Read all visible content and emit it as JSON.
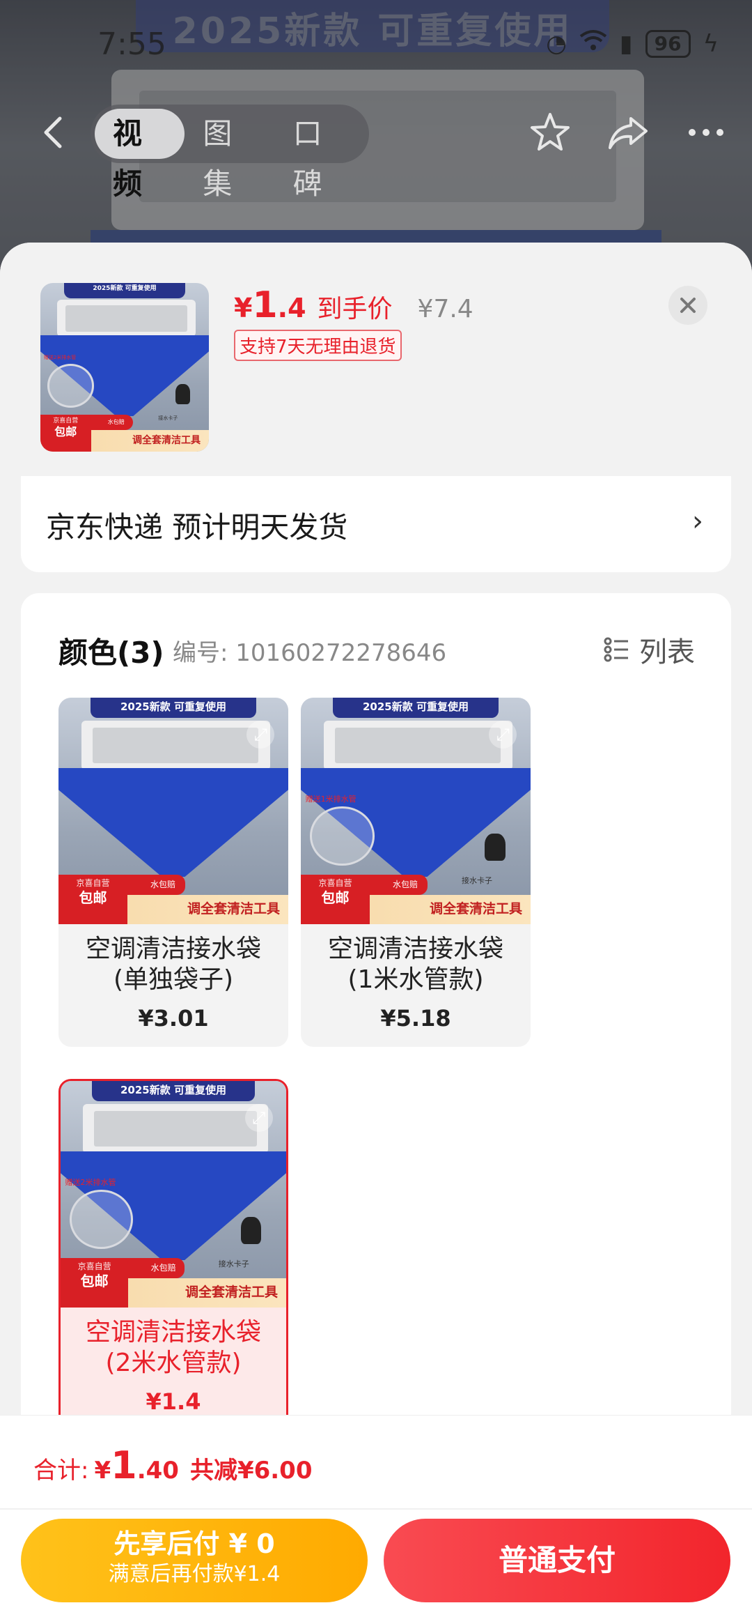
{
  "status_bar": {
    "time": "7:55",
    "battery": "96"
  },
  "background": {
    "banner_text": "2025新款 可重复使用"
  },
  "nav": {
    "tabs": [
      {
        "label": "视频",
        "active": true
      },
      {
        "label": "图集",
        "active": false
      },
      {
        "label": "口碑",
        "active": false
      }
    ],
    "icons": [
      "back-icon",
      "star-icon",
      "share-icon",
      "more-icon"
    ]
  },
  "header": {
    "price_yen": "¥",
    "price_int": "1",
    "price_dec": ".4",
    "price_label": "到手价",
    "original_price": "¥7.4",
    "return_tag": "支持7天无理由退货"
  },
  "product_image": {
    "banner": "2025新款 可重复使用",
    "hose_label_2m": "赠送2米排水管",
    "hose_label_1m": "赠送1米排水管",
    "clip_label": "接水卡子",
    "strip": "调全套清洁工具",
    "redtag": "水包赔",
    "jd_top": "京喜自营",
    "jd_bottom": "包邮"
  },
  "delivery": {
    "text": "京东快递 预计明天发货",
    "arrow": "›"
  },
  "colors": {
    "title": "颜色(3)",
    "code": "编号: 10160272278646",
    "list_label": "列表",
    "options": [
      {
        "name_line1": "空调清洁接水袋",
        "name_line2": "(单独袋子)",
        "price": "¥3.01",
        "selected": false
      },
      {
        "name_line1": "空调清洁接水袋",
        "name_line2": "(1米水管款)",
        "price": "¥5.18",
        "selected": false
      },
      {
        "name_line1": "空调清洁接水袋",
        "name_line2": "(2米水管款)",
        "price": "¥1.4",
        "selected": true
      }
    ]
  },
  "bottom": {
    "total_label": "合计:",
    "total_yen": "¥",
    "total_int": "1",
    "total_dec": ".40",
    "total_save": "共减¥6.00",
    "later_main": "先享后付 ¥ 0",
    "later_sub": "满意后再付款¥1.4",
    "pay_label": "普通支付"
  },
  "colors_theme": {
    "accent": "#e8212b",
    "later_button": "#ffb400",
    "pay_button": "#f2252c"
  }
}
